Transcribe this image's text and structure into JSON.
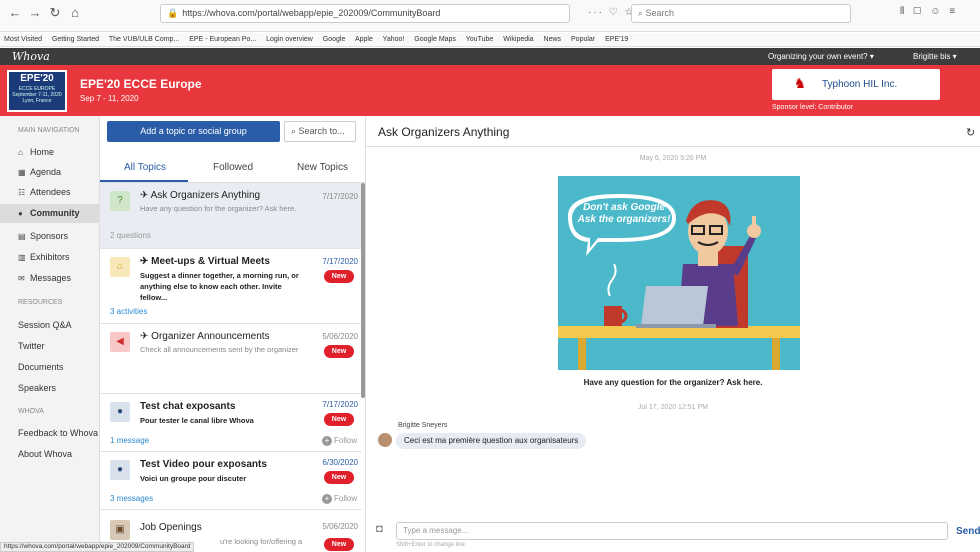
{
  "browser": {
    "url": "https://whova.com/portal/webapp/epie_202009/CommunityBoard",
    "search_placeholder": "Search",
    "bookmarks": [
      "Most Visited",
      "Getting Started",
      "The VUB/ULB Comp...",
      "EPE - European Po...",
      "Login overview",
      "Google",
      "Apple",
      "Yahoo!",
      "Google Maps",
      "YouTube",
      "Wikipedia",
      "News",
      "Popular",
      "EPE'19"
    ]
  },
  "whova": {
    "logo": "Whova",
    "organizing": "Organizing your own event? ▾",
    "user": "Brigitte bis ▾"
  },
  "event": {
    "logo_line1": "EPE'20",
    "logo_line2": "ECCE EUROPE",
    "logo_line3": "September 7-11, 2020",
    "logo_line4": "Lyon, France",
    "title": "EPE'20 ECCE Europe",
    "dates": "Sep 7 - 11, 2020",
    "sponsor_name": "Typhoon HIL Inc.",
    "sponsor_level": "Sponsor level: Contributor"
  },
  "nav": {
    "main_header": "MAIN NAVIGATION",
    "items": [
      "Home",
      "Agenda",
      "Attendees",
      "Community",
      "Sponsors",
      "Exhibitors",
      "Messages"
    ],
    "resources_header": "RESOURCES",
    "resources": [
      "Session Q&A",
      "Twitter",
      "Documents",
      "Speakers"
    ],
    "whova_header": "WHOVA",
    "whova_items": [
      "Feedback to Whova",
      "About Whova"
    ]
  },
  "topics": {
    "add_button": "Add a topic or social group",
    "search_placeholder": "Search to...",
    "tabs": [
      "All Topics",
      "Followed",
      "New Topics"
    ],
    "new_label": "New",
    "follow_label": "Follow",
    "list": [
      {
        "title": "Ask Organizers Anything",
        "desc": "Have any question for the organizer? Ask here.",
        "date": "7/17/2020",
        "meta": "2 questions"
      },
      {
        "title": "Meet-ups & Virtual Meets",
        "desc": "Suggest a dinner together, a morning run, or anything else to know each other. Invite fellow...",
        "date": "7/17/2020",
        "meta": "3 activities"
      },
      {
        "title": "Organizer Announcements",
        "desc": "Check all announcements sent by the organizer",
        "date": "5/06/2020"
      },
      {
        "title": "Test chat exposants",
        "desc": "Pour tester le canal libre Whova",
        "date": "7/17/2020",
        "meta": "1 message"
      },
      {
        "title": "Test Video pour exposants",
        "desc": "Voici un groupe pour discuter",
        "date": "6/30/2020",
        "meta": "3 messages"
      },
      {
        "title": "Job Openings",
        "desc": "u're looking for/offering a",
        "date": "5/06/2020"
      }
    ]
  },
  "chat": {
    "title": "Ask Organizers Anything",
    "timestamp1": "May 6, 2020 5:26 PM",
    "bubble_line1": "Don't ask Google",
    "bubble_line2": "Ask the organizers!",
    "caption": "Have any question for the organizer? Ask here.",
    "timestamp2": "Jul 17, 2020 12:51 PM",
    "sender": "Brigitte Sneyers",
    "message": "Ceci est ma première question aux organisateurs",
    "input_placeholder": "Type a message...",
    "hint": "Shift+Enter to change line",
    "send": "Send"
  },
  "status_url": "https://whova.com/portal/webapp/epie_202009/CommunityBoard"
}
